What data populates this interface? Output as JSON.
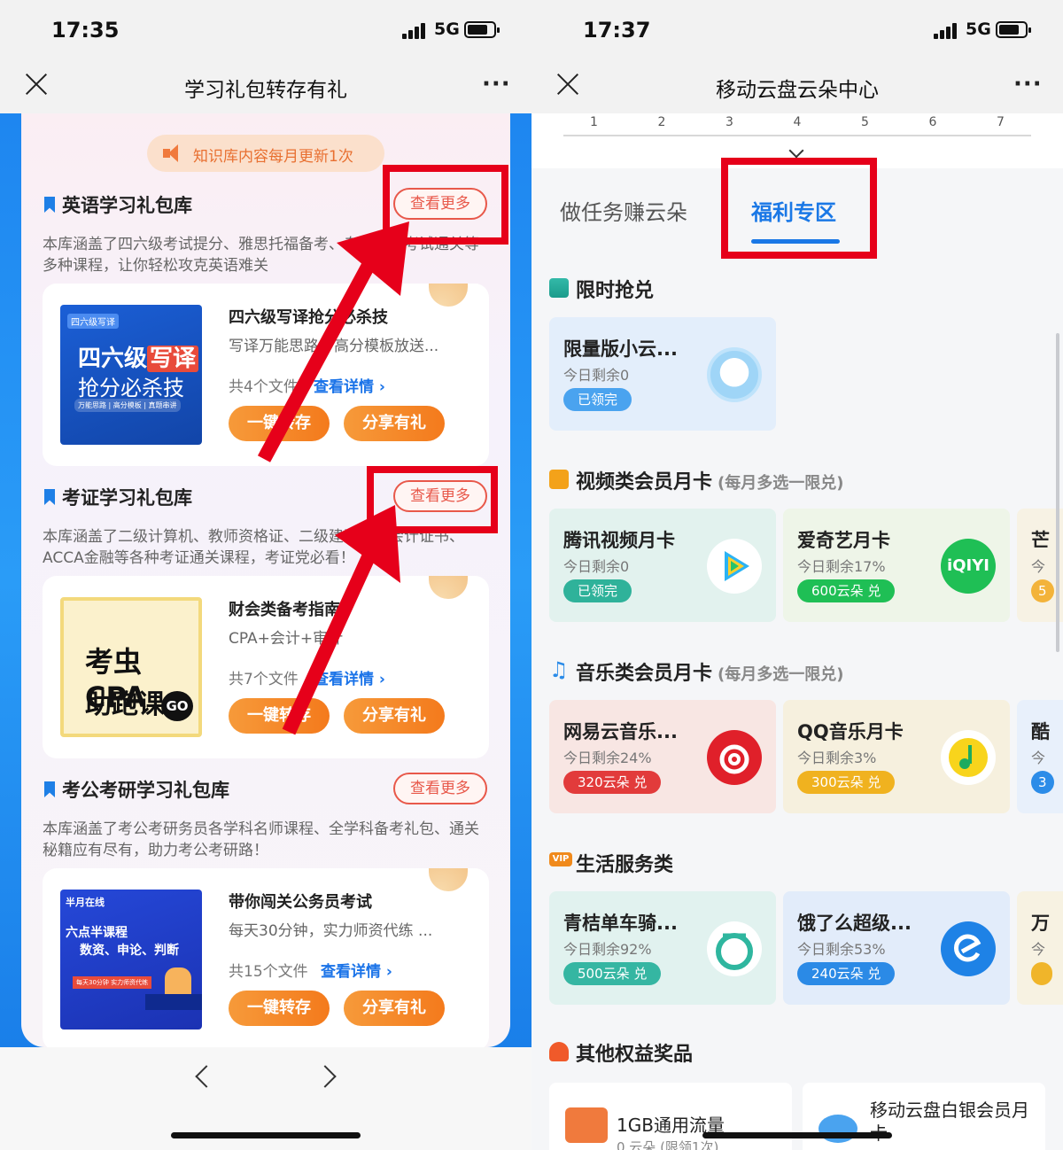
{
  "left": {
    "status": {
      "time": "17:35",
      "network": "5G"
    },
    "nav": {
      "title": "学习礼包转存有礼",
      "more": "···"
    },
    "notice": "知识库内容每月更新1次",
    "sections": [
      {
        "title": "英语学习礼包库",
        "more": "查看更多",
        "desc": "本库涵盖了四六级考试提分、雅思托福备考、专业英语考试通关等多种课程，让你轻松攻克英语难关",
        "item": {
          "title": "四六级写译抢分必杀技",
          "sub": "写译万能思路、高分模板放送...",
          "files": "共4个文件",
          "detail": "查看详情 ›",
          "save": "一键转存",
          "share": "分享有礼",
          "cover": {
            "tag": "四六级写译",
            "line1a": "四六级",
            "line1b": "写译",
            "line2": "抢分必杀技",
            "line3": "万能思路 | 高分模板 | 真题串讲"
          }
        }
      },
      {
        "title": "考证学习礼包库",
        "more": "查看更多",
        "desc": "本库涵盖了二级计算机、教师资格证、二级建造师、会计证书、ACCA金融等各种考证通关课程，考证党必看！",
        "item": {
          "title": "财会类备考指南",
          "sub": "CPA+会计+审计",
          "files": "共7个文件",
          "detail": "查看详情 ›",
          "save": "一键转存",
          "share": "分享有礼",
          "cover": {
            "line1": "考虫CPA",
            "line2": "助跑课",
            "go": "GO"
          }
        }
      },
      {
        "title": "考公考研学习礼包库",
        "more": "查看更多",
        "desc": "本库涵盖了考公考研务员各学科名师课程、全学科备考礼包、通关秘籍应有尽有，助力考公考研路！",
        "item": {
          "title": "带你闯关公务员考试",
          "sub": "每天30分钟，实力师资代练 ...",
          "files": "共15个文件",
          "detail": "查看详情 ›",
          "save": "一键转存",
          "share": "分享有礼",
          "cover": {
            "brand": "半月在线",
            "line1": "六点半课程",
            "line2": "数资、申论、判断",
            "line3": "每天30分钟 实力师资代练"
          }
        }
      }
    ],
    "bottom": {
      "back": "‹",
      "forward": "›"
    }
  },
  "right": {
    "status": {
      "time": "17:37",
      "network": "5G"
    },
    "nav": {
      "title": "移动云盘云朵中心",
      "more": "···"
    },
    "ticks": [
      "1",
      "2",
      "3",
      "4",
      "5",
      "6",
      "7"
    ],
    "tabs": [
      "做任务赚云朵",
      "福利专区"
    ],
    "sections": {
      "flash": {
        "title": "限时抢兑",
        "cards": [
          {
            "title": "限量版小云...",
            "sub": "今日剩余0",
            "pill": "已领完"
          }
        ]
      },
      "video": {
        "title": "视频类会员月卡",
        "note": "(每月多选一限兑)",
        "cards": [
          {
            "title": "腾讯视频月卡",
            "sub": "今日剩余0",
            "pill": "已领完"
          },
          {
            "title": "爱奇艺月卡",
            "sub": "今日剩余17%",
            "pill": "600云朵 兑",
            "logo": "iQIYI"
          },
          {
            "title": "芒",
            "sub": "今",
            "pill": "5"
          }
        ]
      },
      "music": {
        "title": "音乐类会员月卡",
        "note": "(每月多选一限兑)",
        "cards": [
          {
            "title": "网易云音乐...",
            "sub": "今日剩余24%",
            "pill": "320云朵 兑"
          },
          {
            "title": "QQ音乐月卡",
            "sub": "今日剩余3%",
            "pill": "300云朵 兑"
          },
          {
            "title": "酷",
            "sub": "今",
            "pill": "3"
          }
        ]
      },
      "life": {
        "title": "生活服务类",
        "cards": [
          {
            "title": "青桔单车骑...",
            "sub": "今日剩余92%",
            "pill": "500云朵 兑"
          },
          {
            "title": "饿了么超级...",
            "sub": "今日剩余53%",
            "pill": "240云朵 兑"
          },
          {
            "title": "万",
            "sub": "今",
            "pill": ""
          }
        ]
      },
      "other": {
        "title": "其他权益奖品",
        "cards": [
          {
            "title": "1GB通用流量",
            "sub": "0 云朵 (限领1次)"
          },
          {
            "title": "移动云盘白银会员月卡"
          }
        ]
      }
    }
  },
  "colors": {
    "accent_blue": "#1a78e6",
    "orange": "#f47a1c",
    "highlight_red": "#e6001a"
  }
}
